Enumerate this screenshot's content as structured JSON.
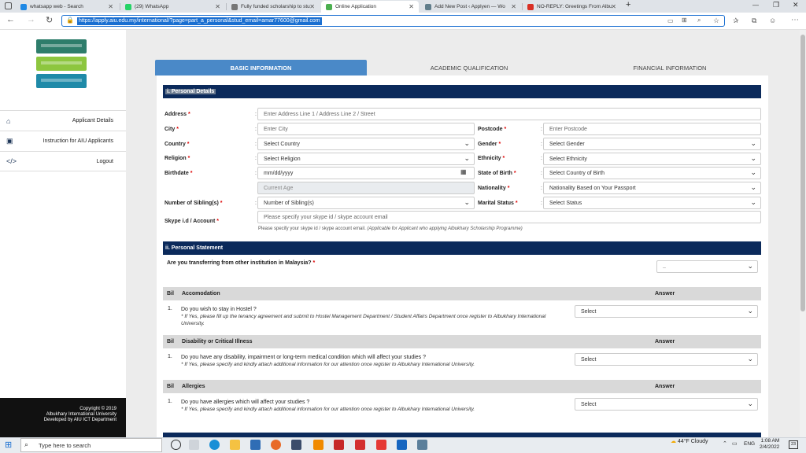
{
  "browser": {
    "tabs": [
      {
        "label": "whatsapp web - Search",
        "color": "#1e88e5"
      },
      {
        "label": "(29) WhatsApp",
        "color": "#25d366"
      },
      {
        "label": "Fully funded scholarship to stud",
        "color": "#777"
      },
      {
        "label": "Online Application",
        "color": "#4caf50"
      },
      {
        "label": "Add New Post ‹ Applyen — Wo",
        "color": "#607d8b"
      },
      {
        "label": "NO-REPLY: Greetings From Albu",
        "color": "#d93025"
      }
    ],
    "new_tab": "+",
    "url": "https://apply.aiu.edu.my/international/?page=part_a_personal&stud_email=amar77600@gmail.com"
  },
  "sidebar": {
    "items": [
      {
        "label": "Applicant Details",
        "icon": "home-icon"
      },
      {
        "label": "Instruction for AIU Applicants",
        "icon": "bus-icon"
      },
      {
        "label": "Logout",
        "icon": "code-icon"
      }
    ],
    "footer": [
      "Copyright © 2019",
      "Albukhary International University",
      "Developed by AIU ICT Department"
    ]
  },
  "form_tabs": [
    "BASIC INFORMATION",
    "ACADEMIC QUALIFICATION",
    "FINANCIAL INFORMATION"
  ],
  "section1": "i. Personal Details",
  "fields": {
    "address": {
      "label": "Address",
      "placeholder": "Enter Address Line 1 / Address Line 2 / Street"
    },
    "city": {
      "label": "City",
      "placeholder": "Enter City"
    },
    "postcode": {
      "label": "Postcode",
      "placeholder": "Enter Postcode"
    },
    "country": {
      "label": "Country",
      "value": "Select Country"
    },
    "gender": {
      "label": "Gender",
      "value": "Select Gender"
    },
    "religion": {
      "label": "Religion",
      "value": "Select Religion"
    },
    "ethnicity": {
      "label": "Ethnicity",
      "value": "Select Ethnicity"
    },
    "birthdate": {
      "label": "Birthdate",
      "placeholder": "mm/dd/yyyy"
    },
    "state_of_birth": {
      "label": "State of Birth",
      "value": "Select Country of Birth"
    },
    "current_age": {
      "placeholder": "Current Age"
    },
    "nationality": {
      "label": "Nationality",
      "value": "Nationality Based on Your Passport"
    },
    "siblings": {
      "label": "Number of Sibling(s)",
      "value": "Number of Sibling(s)"
    },
    "marital": {
      "label": "Marital Status",
      "value": "Select Status"
    },
    "skype": {
      "label": "Skype i.d / Account",
      "placeholder": "Please specify your skype id / skype account email",
      "note": "Please specify your skype id / skype account email.",
      "note_italic": "(Applicable for Applicant who applying Albukhary Scholarship Programme)"
    }
  },
  "section2": "ii. Personal Statement",
  "transfer": {
    "question": "Are you transferring from other institution in Malaysia?",
    "value": ".."
  },
  "table": {
    "col_bil": "Bil",
    "col_answer": "Answer",
    "groups": [
      {
        "title": "Accomodation",
        "num": "1.",
        "question": "Do you wish to stay in Hostel ?",
        "note": "* If Yes, please fill up the tenancy agreement and submit to Hostel Management Department / Student Affairs Department once register to Albukhary International University.",
        "answer": "Select"
      },
      {
        "title": "Disability or Critical Illness",
        "num": "1.",
        "question": "Do you have any disability, impairment or long-term medical condition which will affect your studies ?",
        "note": "* If Yes, please specify and kindly attach additional information for our attention once register to Albukhary International University.",
        "answer": "Select"
      },
      {
        "title": "Allergies",
        "num": "1.",
        "question": "Do you have allergies which will affect your studies ?",
        "note": "* If Yes, please specify and kindly attach additional information for our attention once register to Albukhary International University.",
        "answer": "Select"
      }
    ]
  },
  "taskbar": {
    "search": "Type here to search",
    "weather": "44°F Cloudy",
    "lang": "ENG",
    "time": "1:08 AM",
    "date": "2/4/2022",
    "notif": "23"
  }
}
